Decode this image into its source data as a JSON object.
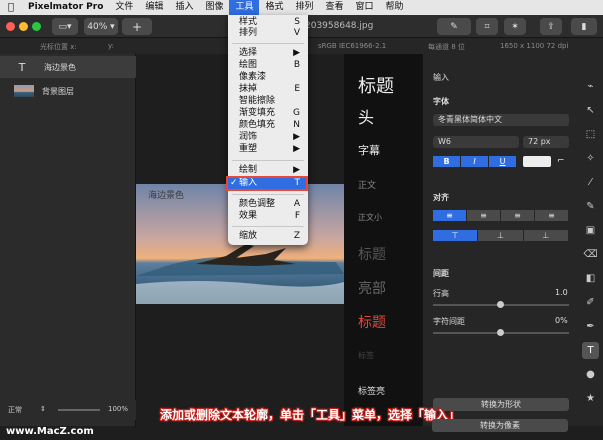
{
  "menubar": {
    "apple": "",
    "items": [
      "Pixelmator Pro",
      "文件",
      "编辑",
      "插入",
      "图像",
      "工具",
      "格式",
      "排列",
      "查看",
      "窗口",
      "帮助"
    ],
    "active_index": 5
  },
  "toolbar": {
    "zoom": "40%",
    "add": "+",
    "title": "203958648.jpg"
  },
  "info": {
    "cursor_label": "光标位置 x:",
    "y_label": "y:",
    "colorspace": "sRGB IEC61966-2.1",
    "depth": "每通道 8 位",
    "dimensions": "1650 x 1100 72 dpi"
  },
  "layers": [
    {
      "name": "海边景色",
      "icon": "T"
    },
    {
      "name": "背景图层",
      "icon": "image-thumb"
    }
  ],
  "canvas": {
    "overlay_text": "海边景色"
  },
  "font_samples": [
    "标题",
    "头",
    "字幕",
    "正文",
    "正文小",
    "标题",
    "亮部",
    "标题",
    "标签",
    "标签亮"
  ],
  "inspector": {
    "section": "输入",
    "font_label": "字体",
    "font_name": "冬青黑体简体中文",
    "weight": "W6",
    "size": "72 px",
    "style_buttons": [
      "B",
      "I",
      "U"
    ],
    "align_label": "对齐",
    "spacing_label": "间距",
    "line_height_label": "行高",
    "line_height_value": "1.0",
    "letter_spacing_label": "字符间距",
    "letter_spacing_value": "0%",
    "convert_shape": "转换为形状",
    "convert_pixels": "转换为像素"
  },
  "tool_menu": {
    "items": [
      {
        "label": "样式",
        "shortcut": "S"
      },
      {
        "label": "排列",
        "shortcut": "V"
      },
      {
        "label": "选择",
        "shortcut": "▶"
      },
      {
        "label": "绘图",
        "shortcut": "B"
      },
      {
        "label": "像素漆",
        "shortcut": ""
      },
      {
        "label": "抹掉",
        "shortcut": "E"
      },
      {
        "label": "智能擦除",
        "shortcut": ""
      },
      {
        "label": "渐变填充",
        "shortcut": "G"
      },
      {
        "label": "颜色填充",
        "shortcut": "N"
      },
      {
        "label": "润饰",
        "shortcut": "▶"
      },
      {
        "label": "重塑",
        "shortcut": "▶"
      },
      {
        "label": "绘制",
        "shortcut": "▶"
      },
      {
        "label": "输入",
        "shortcut": "T",
        "checked": true
      },
      {
        "label": "颜色调整",
        "shortcut": "A"
      },
      {
        "label": "效果",
        "shortcut": "F"
      },
      {
        "label": "缩放",
        "shortcut": "Z"
      }
    ]
  },
  "bottom": {
    "blend": "正常",
    "opacity": "100%"
  },
  "caption": "添加或删除文本轮廓，单击「工具」菜单，选择「输入」",
  "watermark": "www.MacZ.com",
  "colors": {
    "accent": "#2f6de0",
    "highlight_box": "#e8483a",
    "red_font": "#e0483a"
  }
}
